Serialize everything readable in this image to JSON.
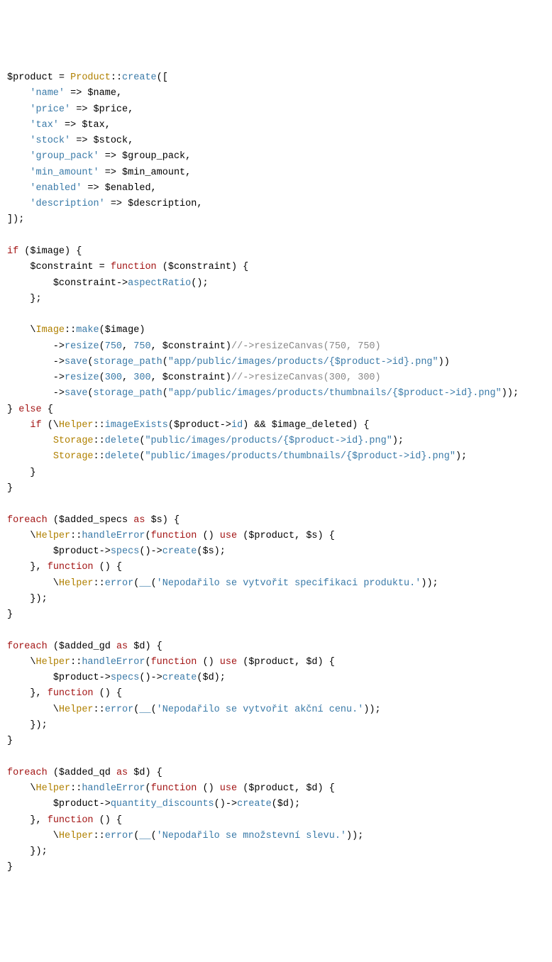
{
  "lines": [
    [
      {
        "t": "$product",
        "c": "k-var"
      },
      {
        "t": " = ",
        "c": "k-op"
      },
      {
        "t": "Product",
        "c": "k-class"
      },
      {
        "t": "::",
        "c": "k-op"
      },
      {
        "t": "create",
        "c": "k-method"
      },
      {
        "t": "([",
        "c": "k-punct"
      }
    ],
    [
      {
        "t": "    ",
        "c": ""
      },
      {
        "t": "'name'",
        "c": "k-str"
      },
      {
        "t": " => ",
        "c": "k-op"
      },
      {
        "t": "$name",
        "c": "k-var"
      },
      {
        "t": ",",
        "c": "k-punct"
      }
    ],
    [
      {
        "t": "    ",
        "c": ""
      },
      {
        "t": "'price'",
        "c": "k-str"
      },
      {
        "t": " => ",
        "c": "k-op"
      },
      {
        "t": "$price",
        "c": "k-var"
      },
      {
        "t": ",",
        "c": "k-punct"
      }
    ],
    [
      {
        "t": "    ",
        "c": ""
      },
      {
        "t": "'tax'",
        "c": "k-str"
      },
      {
        "t": " => ",
        "c": "k-op"
      },
      {
        "t": "$tax",
        "c": "k-var"
      },
      {
        "t": ",",
        "c": "k-punct"
      }
    ],
    [
      {
        "t": "    ",
        "c": ""
      },
      {
        "t": "'stock'",
        "c": "k-str"
      },
      {
        "t": " => ",
        "c": "k-op"
      },
      {
        "t": "$stock",
        "c": "k-var"
      },
      {
        "t": ",",
        "c": "k-punct"
      }
    ],
    [
      {
        "t": "    ",
        "c": ""
      },
      {
        "t": "'group_pack'",
        "c": "k-str"
      },
      {
        "t": " => ",
        "c": "k-op"
      },
      {
        "t": "$group_pack",
        "c": "k-var"
      },
      {
        "t": ",",
        "c": "k-punct"
      }
    ],
    [
      {
        "t": "    ",
        "c": ""
      },
      {
        "t": "'min_amount'",
        "c": "k-str"
      },
      {
        "t": " => ",
        "c": "k-op"
      },
      {
        "t": "$min_amount",
        "c": "k-var"
      },
      {
        "t": ",",
        "c": "k-punct"
      }
    ],
    [
      {
        "t": "    ",
        "c": ""
      },
      {
        "t": "'enabled'",
        "c": "k-str"
      },
      {
        "t": " => ",
        "c": "k-op"
      },
      {
        "t": "$enabled",
        "c": "k-var"
      },
      {
        "t": ",",
        "c": "k-punct"
      }
    ],
    [
      {
        "t": "    ",
        "c": ""
      },
      {
        "t": "'description'",
        "c": "k-str"
      },
      {
        "t": " => ",
        "c": "k-op"
      },
      {
        "t": "$description",
        "c": "k-var"
      },
      {
        "t": ",",
        "c": "k-punct"
      }
    ],
    [
      {
        "t": "]);",
        "c": "k-punct"
      }
    ],
    [],
    [
      {
        "t": "if",
        "c": "k-kw"
      },
      {
        "t": " (",
        "c": "k-punct"
      },
      {
        "t": "$image",
        "c": "k-var"
      },
      {
        "t": ") {",
        "c": "k-punct"
      }
    ],
    [
      {
        "t": "    ",
        "c": ""
      },
      {
        "t": "$constraint",
        "c": "k-var"
      },
      {
        "t": " = ",
        "c": "k-op"
      },
      {
        "t": "function",
        "c": "k-kw"
      },
      {
        "t": " (",
        "c": "k-punct"
      },
      {
        "t": "$constraint",
        "c": "k-var"
      },
      {
        "t": ") {",
        "c": "k-punct"
      }
    ],
    [
      {
        "t": "        ",
        "c": ""
      },
      {
        "t": "$constraint",
        "c": "k-var"
      },
      {
        "t": "->",
        "c": "k-op"
      },
      {
        "t": "aspectRatio",
        "c": "k-method"
      },
      {
        "t": "();",
        "c": "k-punct"
      }
    ],
    [
      {
        "t": "    };",
        "c": "k-punct"
      }
    ],
    [],
    [
      {
        "t": "    \\",
        "c": "k-punct"
      },
      {
        "t": "Image",
        "c": "k-class"
      },
      {
        "t": "::",
        "c": "k-op"
      },
      {
        "t": "make",
        "c": "k-method"
      },
      {
        "t": "(",
        "c": "k-punct"
      },
      {
        "t": "$image",
        "c": "k-var"
      },
      {
        "t": ")",
        "c": "k-punct"
      }
    ],
    [
      {
        "t": "        ->",
        "c": "k-op"
      },
      {
        "t": "resize",
        "c": "k-method"
      },
      {
        "t": "(",
        "c": "k-punct"
      },
      {
        "t": "750",
        "c": "k-num"
      },
      {
        "t": ", ",
        "c": "k-punct"
      },
      {
        "t": "750",
        "c": "k-num"
      },
      {
        "t": ", ",
        "c": "k-punct"
      },
      {
        "t": "$constraint",
        "c": "k-var"
      },
      {
        "t": ")",
        "c": "k-punct"
      },
      {
        "t": "//->resizeCanvas(750, 750)",
        "c": "k-cmt"
      }
    ],
    [
      {
        "t": "        ->",
        "c": "k-op"
      },
      {
        "t": "save",
        "c": "k-method"
      },
      {
        "t": "(",
        "c": "k-punct"
      },
      {
        "t": "storage_path",
        "c": "k-method"
      },
      {
        "t": "(",
        "c": "k-punct"
      },
      {
        "t": "\"app/public/images/products/{$product->id}.png\"",
        "c": "k-str"
      },
      {
        "t": "))",
        "c": "k-punct"
      }
    ],
    [
      {
        "t": "        ->",
        "c": "k-op"
      },
      {
        "t": "resize",
        "c": "k-method"
      },
      {
        "t": "(",
        "c": "k-punct"
      },
      {
        "t": "300",
        "c": "k-num"
      },
      {
        "t": ", ",
        "c": "k-punct"
      },
      {
        "t": "300",
        "c": "k-num"
      },
      {
        "t": ", ",
        "c": "k-punct"
      },
      {
        "t": "$constraint",
        "c": "k-var"
      },
      {
        "t": ")",
        "c": "k-punct"
      },
      {
        "t": "//->resizeCanvas(300, 300)",
        "c": "k-cmt"
      }
    ],
    [
      {
        "t": "        ->",
        "c": "k-op"
      },
      {
        "t": "save",
        "c": "k-method"
      },
      {
        "t": "(",
        "c": "k-punct"
      },
      {
        "t": "storage_path",
        "c": "k-method"
      },
      {
        "t": "(",
        "c": "k-punct"
      },
      {
        "t": "\"app/public/images/products/thumbnails/{$product->id}.png\"",
        "c": "k-str"
      },
      {
        "t": "));",
        "c": "k-punct"
      }
    ],
    [
      {
        "t": "} ",
        "c": "k-punct"
      },
      {
        "t": "else",
        "c": "k-kw"
      },
      {
        "t": " {",
        "c": "k-punct"
      }
    ],
    [
      {
        "t": "    ",
        "c": ""
      },
      {
        "t": "if",
        "c": "k-kw"
      },
      {
        "t": " (\\",
        "c": "k-punct"
      },
      {
        "t": "Helper",
        "c": "k-class"
      },
      {
        "t": "::",
        "c": "k-op"
      },
      {
        "t": "imageExists",
        "c": "k-method"
      },
      {
        "t": "(",
        "c": "k-punct"
      },
      {
        "t": "$product",
        "c": "k-var"
      },
      {
        "t": "->",
        "c": "k-op"
      },
      {
        "t": "id",
        "c": "k-method"
      },
      {
        "t": ") && ",
        "c": "k-punct"
      },
      {
        "t": "$image_deleted",
        "c": "k-var"
      },
      {
        "t": ") {",
        "c": "k-punct"
      }
    ],
    [
      {
        "t": "        ",
        "c": ""
      },
      {
        "t": "Storage",
        "c": "k-class"
      },
      {
        "t": "::",
        "c": "k-op"
      },
      {
        "t": "delete",
        "c": "k-method"
      },
      {
        "t": "(",
        "c": "k-punct"
      },
      {
        "t": "\"public/images/products/{$product->id}.png\"",
        "c": "k-str"
      },
      {
        "t": ");",
        "c": "k-punct"
      }
    ],
    [
      {
        "t": "        ",
        "c": ""
      },
      {
        "t": "Storage",
        "c": "k-class"
      },
      {
        "t": "::",
        "c": "k-op"
      },
      {
        "t": "delete",
        "c": "k-method"
      },
      {
        "t": "(",
        "c": "k-punct"
      },
      {
        "t": "\"public/images/products/thumbnails/{$product->id}.png\"",
        "c": "k-str"
      },
      {
        "t": ");",
        "c": "k-punct"
      }
    ],
    [
      {
        "t": "    }",
        "c": "k-punct"
      }
    ],
    [
      {
        "t": "}",
        "c": "k-punct"
      }
    ],
    [],
    [
      {
        "t": "foreach",
        "c": "k-kw"
      },
      {
        "t": " (",
        "c": "k-punct"
      },
      {
        "t": "$added_specs",
        "c": "k-var"
      },
      {
        "t": " ",
        "c": ""
      },
      {
        "t": "as",
        "c": "k-kw2"
      },
      {
        "t": " ",
        "c": ""
      },
      {
        "t": "$s",
        "c": "k-var"
      },
      {
        "t": ") {",
        "c": "k-punct"
      }
    ],
    [
      {
        "t": "    \\",
        "c": "k-punct"
      },
      {
        "t": "Helper",
        "c": "k-class"
      },
      {
        "t": "::",
        "c": "k-op"
      },
      {
        "t": "handleError",
        "c": "k-method"
      },
      {
        "t": "(",
        "c": "k-punct"
      },
      {
        "t": "function",
        "c": "k-kw"
      },
      {
        "t": " () ",
        "c": "k-punct"
      },
      {
        "t": "use",
        "c": "k-kw"
      },
      {
        "t": " (",
        "c": "k-punct"
      },
      {
        "t": "$product",
        "c": "k-var"
      },
      {
        "t": ", ",
        "c": "k-punct"
      },
      {
        "t": "$s",
        "c": "k-var"
      },
      {
        "t": ") {",
        "c": "k-punct"
      }
    ],
    [
      {
        "t": "        ",
        "c": ""
      },
      {
        "t": "$product",
        "c": "k-var"
      },
      {
        "t": "->",
        "c": "k-op"
      },
      {
        "t": "specs",
        "c": "k-method"
      },
      {
        "t": "()->",
        "c": "k-op"
      },
      {
        "t": "create",
        "c": "k-method"
      },
      {
        "t": "(",
        "c": "k-punct"
      },
      {
        "t": "$s",
        "c": "k-var"
      },
      {
        "t": ");",
        "c": "k-punct"
      }
    ],
    [
      {
        "t": "    }, ",
        "c": "k-punct"
      },
      {
        "t": "function",
        "c": "k-kw"
      },
      {
        "t": " () {",
        "c": "k-punct"
      }
    ],
    [
      {
        "t": "        \\",
        "c": "k-punct"
      },
      {
        "t": "Helper",
        "c": "k-class"
      },
      {
        "t": "::",
        "c": "k-op"
      },
      {
        "t": "error",
        "c": "k-method"
      },
      {
        "t": "(",
        "c": "k-punct"
      },
      {
        "t": "__",
        "c": "k-method"
      },
      {
        "t": "(",
        "c": "k-punct"
      },
      {
        "t": "'Nepodařilo se vytvořit specifikaci produktu.'",
        "c": "k-str"
      },
      {
        "t": "));",
        "c": "k-punct"
      }
    ],
    [
      {
        "t": "    });",
        "c": "k-punct"
      }
    ],
    [
      {
        "t": "}",
        "c": "k-punct"
      }
    ],
    [],
    [
      {
        "t": "foreach",
        "c": "k-kw"
      },
      {
        "t": " (",
        "c": "k-punct"
      },
      {
        "t": "$added_gd",
        "c": "k-var"
      },
      {
        "t": " ",
        "c": ""
      },
      {
        "t": "as",
        "c": "k-kw2"
      },
      {
        "t": " ",
        "c": ""
      },
      {
        "t": "$d",
        "c": "k-var"
      },
      {
        "t": ") {",
        "c": "k-punct"
      }
    ],
    [
      {
        "t": "    \\",
        "c": "k-punct"
      },
      {
        "t": "Helper",
        "c": "k-class"
      },
      {
        "t": "::",
        "c": "k-op"
      },
      {
        "t": "handleError",
        "c": "k-method"
      },
      {
        "t": "(",
        "c": "k-punct"
      },
      {
        "t": "function",
        "c": "k-kw"
      },
      {
        "t": " () ",
        "c": "k-punct"
      },
      {
        "t": "use",
        "c": "k-kw"
      },
      {
        "t": " (",
        "c": "k-punct"
      },
      {
        "t": "$product",
        "c": "k-var"
      },
      {
        "t": ", ",
        "c": "k-punct"
      },
      {
        "t": "$d",
        "c": "k-var"
      },
      {
        "t": ") {",
        "c": "k-punct"
      }
    ],
    [
      {
        "t": "        ",
        "c": ""
      },
      {
        "t": "$product",
        "c": "k-var"
      },
      {
        "t": "->",
        "c": "k-op"
      },
      {
        "t": "specs",
        "c": "k-method"
      },
      {
        "t": "()->",
        "c": "k-op"
      },
      {
        "t": "create",
        "c": "k-method"
      },
      {
        "t": "(",
        "c": "k-punct"
      },
      {
        "t": "$d",
        "c": "k-var"
      },
      {
        "t": ");",
        "c": "k-punct"
      }
    ],
    [
      {
        "t": "    }, ",
        "c": "k-punct"
      },
      {
        "t": "function",
        "c": "k-kw"
      },
      {
        "t": " () {",
        "c": "k-punct"
      }
    ],
    [
      {
        "t": "        \\",
        "c": "k-punct"
      },
      {
        "t": "Helper",
        "c": "k-class"
      },
      {
        "t": "::",
        "c": "k-op"
      },
      {
        "t": "error",
        "c": "k-method"
      },
      {
        "t": "(",
        "c": "k-punct"
      },
      {
        "t": "__",
        "c": "k-method"
      },
      {
        "t": "(",
        "c": "k-punct"
      },
      {
        "t": "'Nepodařilo se vytvořit akční cenu.'",
        "c": "k-str"
      },
      {
        "t": "));",
        "c": "k-punct"
      }
    ],
    [
      {
        "t": "    });",
        "c": "k-punct"
      }
    ],
    [
      {
        "t": "}",
        "c": "k-punct"
      }
    ],
    [],
    [
      {
        "t": "foreach",
        "c": "k-kw"
      },
      {
        "t": " (",
        "c": "k-punct"
      },
      {
        "t": "$added_qd",
        "c": "k-var"
      },
      {
        "t": " ",
        "c": ""
      },
      {
        "t": "as",
        "c": "k-kw2"
      },
      {
        "t": " ",
        "c": ""
      },
      {
        "t": "$d",
        "c": "k-var"
      },
      {
        "t": ") {",
        "c": "k-punct"
      }
    ],
    [
      {
        "t": "    \\",
        "c": "k-punct"
      },
      {
        "t": "Helper",
        "c": "k-class"
      },
      {
        "t": "::",
        "c": "k-op"
      },
      {
        "t": "handleError",
        "c": "k-method"
      },
      {
        "t": "(",
        "c": "k-punct"
      },
      {
        "t": "function",
        "c": "k-kw"
      },
      {
        "t": " () ",
        "c": "k-punct"
      },
      {
        "t": "use",
        "c": "k-kw"
      },
      {
        "t": " (",
        "c": "k-punct"
      },
      {
        "t": "$product",
        "c": "k-var"
      },
      {
        "t": ", ",
        "c": "k-punct"
      },
      {
        "t": "$d",
        "c": "k-var"
      },
      {
        "t": ") {",
        "c": "k-punct"
      }
    ],
    [
      {
        "t": "        ",
        "c": ""
      },
      {
        "t": "$product",
        "c": "k-var"
      },
      {
        "t": "->",
        "c": "k-op"
      },
      {
        "t": "quantity_discounts",
        "c": "k-method"
      },
      {
        "t": "()->",
        "c": "k-op"
      },
      {
        "t": "create",
        "c": "k-method"
      },
      {
        "t": "(",
        "c": "k-punct"
      },
      {
        "t": "$d",
        "c": "k-var"
      },
      {
        "t": ");",
        "c": "k-punct"
      }
    ],
    [
      {
        "t": "    }, ",
        "c": "k-punct"
      },
      {
        "t": "function",
        "c": "k-kw"
      },
      {
        "t": " () {",
        "c": "k-punct"
      }
    ],
    [
      {
        "t": "        \\",
        "c": "k-punct"
      },
      {
        "t": "Helper",
        "c": "k-class"
      },
      {
        "t": "::",
        "c": "k-op"
      },
      {
        "t": "error",
        "c": "k-method"
      },
      {
        "t": "(",
        "c": "k-punct"
      },
      {
        "t": "__",
        "c": "k-method"
      },
      {
        "t": "(",
        "c": "k-punct"
      },
      {
        "t": "'Nepodařilo se množstevní slevu.'",
        "c": "k-str"
      },
      {
        "t": "));",
        "c": "k-punct"
      }
    ],
    [
      {
        "t": "    });",
        "c": "k-punct"
      }
    ],
    [
      {
        "t": "}",
        "c": "k-punct"
      }
    ]
  ]
}
